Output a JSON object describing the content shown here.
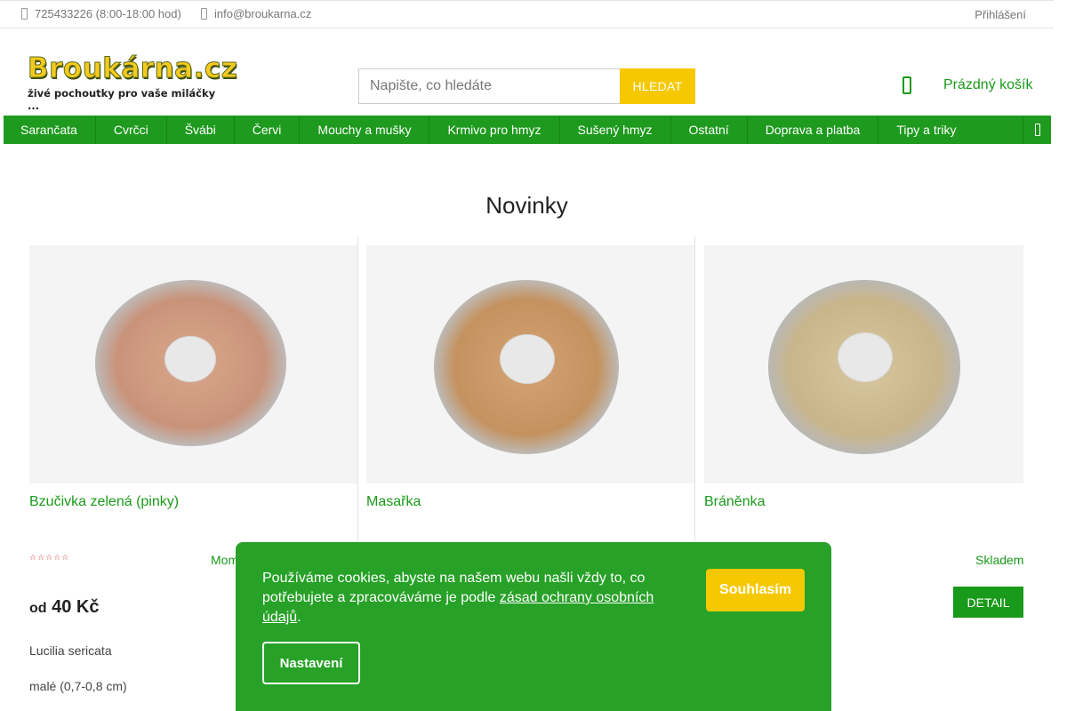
{
  "topbar": {
    "phone": "725433226 (8:00-18:00 hod)",
    "email": "info@broukarna.cz",
    "login": "Přihlášení"
  },
  "header": {
    "logo_brand": "Broukárna.cz",
    "logo_tagline": "živé pochoutky pro vaše miláčky ...",
    "search_placeholder": "Napište, co hledáte",
    "search_button": "HLEDAT",
    "cart_label": "Prázdný košík"
  },
  "nav": {
    "items": [
      "Sarančata",
      "Cvrčci",
      "Švábi",
      "Červi",
      "Mouchy a mušky",
      "Krmivo pro hmyz",
      "Sušený hmyz",
      "Ostatní",
      "Doprava a platba",
      "Tipy a triky"
    ]
  },
  "section": {
    "title": "Novinky"
  },
  "products": [
    {
      "name": "Bzučivka zelená (pinky)",
      "stock": "Mom",
      "price_prefix": "od",
      "price": "40 Kč",
      "latin": "Lucilia sericata",
      "size": "malé (0,7-0,8 cm)",
      "dish_color": "#d9a88c",
      "rating_stars": 5
    },
    {
      "name": "Masařka",
      "dish_color": "#d6a376"
    },
    {
      "name": "Bráněnka",
      "stock": "Skladem",
      "detail_button": "DETAIL",
      "dish_color": "#d8c7a0"
    }
  ],
  "cookie": {
    "text_before_link": "Používáme cookies, abyste na našem webu našli vždy to, co potřebujete a zpracováváme je podle ",
    "link_text": "zásad ochrany osobních údajů",
    "text_after_link": ".",
    "agree_button": "Souhlasím",
    "settings_button": "Nastavení"
  },
  "colors": {
    "brand_green": "#1e9a1e",
    "accent_yellow": "#f6c800",
    "cookie_green": "#27a127"
  }
}
